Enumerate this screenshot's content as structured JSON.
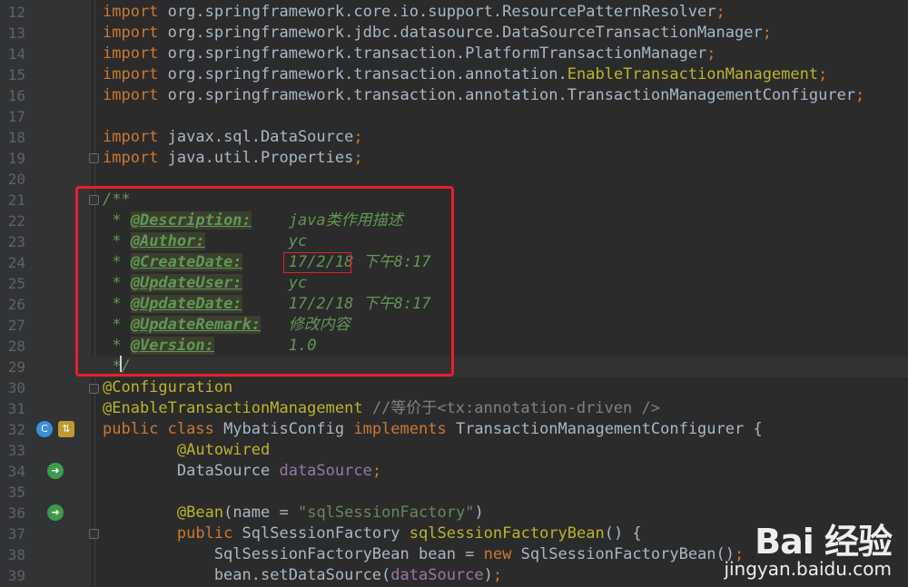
{
  "editor": {
    "lines": [
      {
        "n": "12",
        "t": [
          [
            "kw",
            "import "
          ],
          [
            "",
            "org.springframework.core.io.support.ResourcePatternResolver"
          ],
          [
            "semi",
            ";"
          ]
        ]
      },
      {
        "n": "13",
        "t": [
          [
            "kw",
            "import "
          ],
          [
            "",
            "org.springframework.jdbc.datasource.DataSourceTransactionManager"
          ],
          [
            "semi",
            ";"
          ]
        ]
      },
      {
        "n": "14",
        "t": [
          [
            "kw",
            "import "
          ],
          [
            "",
            "org.springframework.transaction.PlatformTransactionManager"
          ],
          [
            "semi",
            ";"
          ]
        ]
      },
      {
        "n": "15",
        "t": [
          [
            "kw",
            "import "
          ],
          [
            "",
            "org.springframework.transaction.annotation."
          ],
          [
            "ann",
            "EnableTransactionManagement"
          ],
          [
            "semi",
            ";"
          ]
        ]
      },
      {
        "n": "16",
        "t": [
          [
            "kw",
            "import "
          ],
          [
            "",
            "org.springframework.transaction.annotation.TransactionManagementConfigurer"
          ],
          [
            "semi",
            ";"
          ]
        ]
      },
      {
        "n": "17",
        "t": []
      },
      {
        "n": "18",
        "t": [
          [
            "kw",
            "import "
          ],
          [
            "",
            "javax.sql.DataSource"
          ],
          [
            "semi",
            ";"
          ]
        ]
      },
      {
        "n": "19",
        "t": [
          [
            "kw",
            "import "
          ],
          [
            "",
            "java.util.Properties"
          ],
          [
            "semi",
            ";"
          ]
        ]
      },
      {
        "n": "20",
        "t": []
      },
      {
        "n": "21",
        "t": [
          [
            "doc",
            "/**"
          ]
        ]
      },
      {
        "n": "22",
        "t": [
          [
            "doc",
            " * "
          ],
          [
            "tag",
            "@Description:"
          ],
          [
            "doc",
            "    java类作用描述"
          ]
        ]
      },
      {
        "n": "23",
        "t": [
          [
            "doc",
            " * "
          ],
          [
            "tag",
            "@Author:"
          ],
          [
            "doc",
            "         yc"
          ]
        ]
      },
      {
        "n": "24",
        "t": [
          [
            "doc",
            " * "
          ],
          [
            "tag",
            "@CreateDate:"
          ],
          [
            "doc",
            "     17/2/18 下午8:17"
          ]
        ]
      },
      {
        "n": "25",
        "t": [
          [
            "doc",
            " * "
          ],
          [
            "tag",
            "@UpdateUser:"
          ],
          [
            "doc",
            "     yc"
          ]
        ]
      },
      {
        "n": "26",
        "t": [
          [
            "doc",
            " * "
          ],
          [
            "tag",
            "@UpdateDate:"
          ],
          [
            "doc",
            "     17/2/18 下午8:17"
          ]
        ]
      },
      {
        "n": "27",
        "t": [
          [
            "doc",
            " * "
          ],
          [
            "tag",
            "@UpdateRemark:"
          ],
          [
            "doc",
            "   修改内容"
          ]
        ]
      },
      {
        "n": "28",
        "t": [
          [
            "doc",
            " * "
          ],
          [
            "tag",
            "@Version:"
          ],
          [
            "doc",
            "        1.0"
          ]
        ]
      },
      {
        "n": "29",
        "t": [
          [
            "doc",
            " */"
          ]
        ]
      },
      {
        "n": "30",
        "t": [
          [
            "ann",
            "@Configuration"
          ]
        ]
      },
      {
        "n": "31",
        "t": [
          [
            "ann",
            "@EnableTransactionManagement"
          ],
          [
            "",
            " "
          ],
          [
            "cm",
            "//等价于<tx:annotation-driven />"
          ]
        ]
      },
      {
        "n": "32",
        "t": [
          [
            "kw",
            "public class "
          ],
          [
            "",
            "MybatisConfig "
          ],
          [
            "kw",
            "implements "
          ],
          [
            "",
            "TransactionManagementConfigurer {"
          ]
        ]
      },
      {
        "n": "33",
        "t": [
          [
            "",
            "        "
          ],
          [
            "ann",
            "@Autowired"
          ]
        ]
      },
      {
        "n": "34",
        "t": [
          [
            "",
            "        DataSource "
          ],
          [
            "field",
            "dataSource"
          ],
          [
            "semi",
            ";"
          ]
        ]
      },
      {
        "n": "35",
        "t": []
      },
      {
        "n": "36",
        "t": [
          [
            "",
            "        "
          ],
          [
            "ann",
            "@Bean"
          ],
          [
            "",
            "(name = "
          ],
          [
            "str",
            "\"sqlSessionFactory\""
          ],
          [
            "",
            ")"
          ]
        ]
      },
      {
        "n": "37",
        "t": [
          [
            "",
            "        "
          ],
          [
            "kw",
            "public "
          ],
          [
            "",
            "SqlSessionFactory "
          ],
          [
            "ann",
            "sqlSessionFactoryBean"
          ],
          [
            "",
            "() {"
          ]
        ]
      },
      {
        "n": "38",
        "t": [
          [
            "",
            "            SqlSessionFactoryBean bean = "
          ],
          [
            "kw",
            "new "
          ],
          [
            "",
            "SqlSessionFactoryBean()"
          ],
          [
            "semi",
            ";"
          ]
        ]
      },
      {
        "n": "39",
        "t": [
          [
            "",
            "            bean.setDataSource("
          ],
          [
            "field",
            "dataSource"
          ],
          [
            "",
            ")"
          ],
          [
            "semi",
            ";"
          ]
        ]
      }
    ]
  },
  "gutter_icons": {
    "line32": [
      "class-icon",
      "implements-icon"
    ],
    "line34": [
      "bean-icon"
    ],
    "line36": [
      "bean-icon"
    ]
  },
  "watermark": {
    "logo": "Bai 经验",
    "url": "jingyan.baidu.com"
  },
  "colors": {
    "background": "#2b2b2b",
    "keyword": "#cc7832",
    "annotation": "#bbb529",
    "doc_comment": "#629755",
    "highlight_box": "#e8202a"
  }
}
